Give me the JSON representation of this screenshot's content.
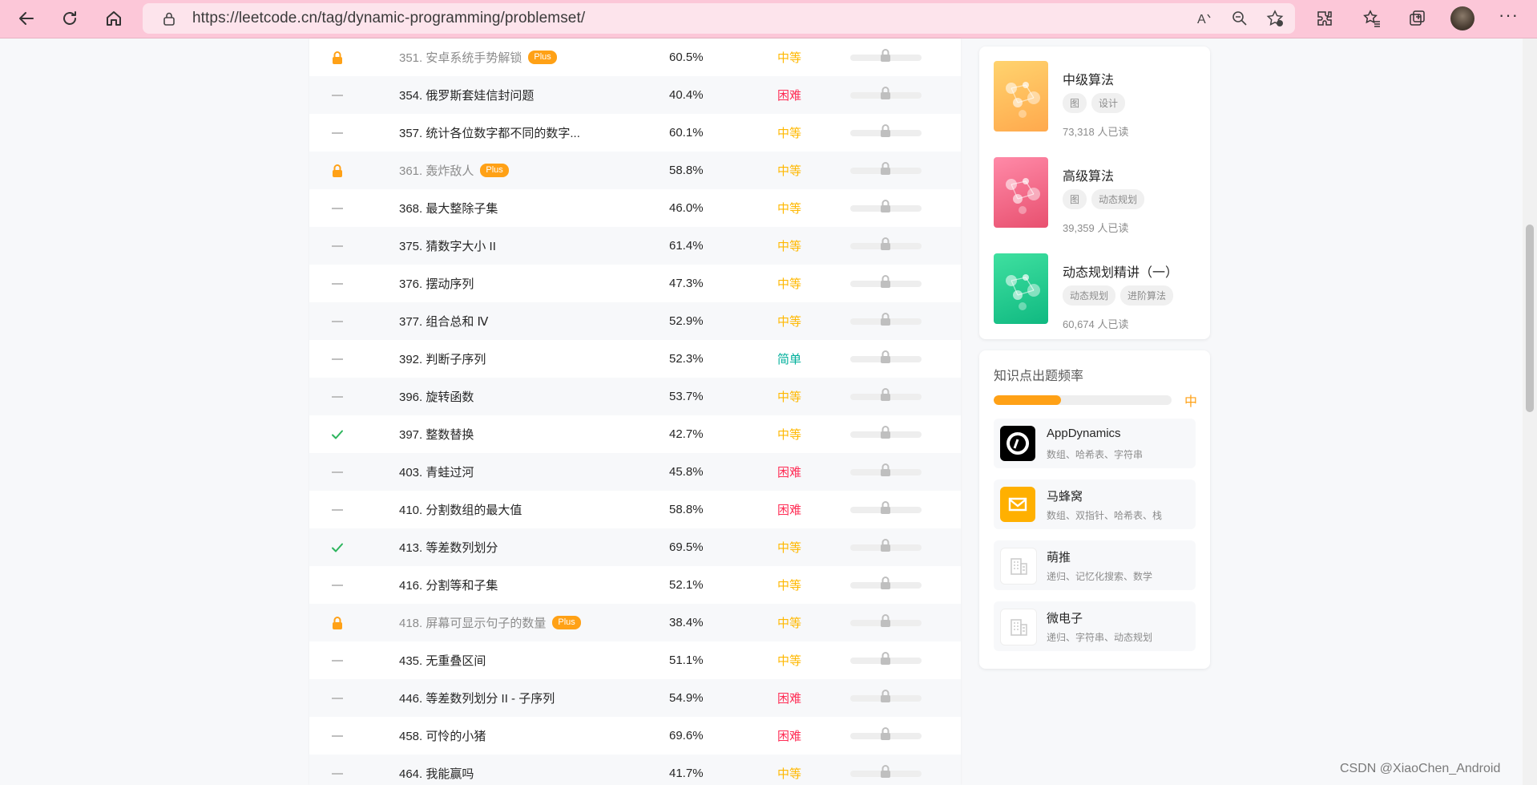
{
  "browser": {
    "url": "https://leetcode.cn/tag/dynamic-programming/problemset/"
  },
  "problems": [
    {
      "status": "locked",
      "title": "351. 安卓系统手势解锁",
      "plus": "Plus",
      "rate": "60.5%",
      "difficulty": "中等",
      "diff_color": "#ffb800"
    },
    {
      "status": "none",
      "title": "354. 俄罗斯套娃信封问题",
      "plus": "",
      "rate": "40.4%",
      "difficulty": "困难",
      "diff_color": "#ff2d55"
    },
    {
      "status": "none",
      "title": "357. 统计各位数字都不同的数字...",
      "plus": "",
      "rate": "60.1%",
      "difficulty": "中等",
      "diff_color": "#ffb800"
    },
    {
      "status": "locked",
      "title": "361. 轰炸敌人",
      "plus": "Plus",
      "rate": "58.8%",
      "difficulty": "中等",
      "diff_color": "#ffb800"
    },
    {
      "status": "none",
      "title": "368. 最大整除子集",
      "plus": "",
      "rate": "46.0%",
      "difficulty": "中等",
      "diff_color": "#ffb800"
    },
    {
      "status": "none",
      "title": "375. 猜数字大小 II",
      "plus": "",
      "rate": "61.4%",
      "difficulty": "中等",
      "diff_color": "#ffb800"
    },
    {
      "status": "none",
      "title": "376. 摆动序列",
      "plus": "",
      "rate": "47.3%",
      "difficulty": "中等",
      "diff_color": "#ffb800"
    },
    {
      "status": "none",
      "title": "377. 组合总和 Ⅳ",
      "plus": "",
      "rate": "52.9%",
      "difficulty": "中等",
      "diff_color": "#ffb800"
    },
    {
      "status": "none",
      "title": "392. 判断子序列",
      "plus": "",
      "rate": "52.3%",
      "difficulty": "简单",
      "diff_color": "#00af9b"
    },
    {
      "status": "none",
      "title": "396. 旋转函数",
      "plus": "",
      "rate": "53.7%",
      "difficulty": "中等",
      "diff_color": "#ffb800"
    },
    {
      "status": "solved",
      "title": "397. 整数替换",
      "plus": "",
      "rate": "42.7%",
      "difficulty": "中等",
      "diff_color": "#ffb800"
    },
    {
      "status": "none",
      "title": "403. 青蛙过河",
      "plus": "",
      "rate": "45.8%",
      "difficulty": "困难",
      "diff_color": "#ff2d55"
    },
    {
      "status": "none",
      "title": "410. 分割数组的最大值",
      "plus": "",
      "rate": "58.8%",
      "difficulty": "困难",
      "diff_color": "#ff2d55"
    },
    {
      "status": "solved",
      "title": "413. 等差数列划分",
      "plus": "",
      "rate": "69.5%",
      "difficulty": "中等",
      "diff_color": "#ffb800"
    },
    {
      "status": "none",
      "title": "416. 分割等和子集",
      "plus": "",
      "rate": "52.1%",
      "difficulty": "中等",
      "diff_color": "#ffb800"
    },
    {
      "status": "locked",
      "title": "418. 屏幕可显示句子的数量",
      "plus": "Plus",
      "rate": "38.4%",
      "difficulty": "中等",
      "diff_color": "#ffb800"
    },
    {
      "status": "none",
      "title": "435. 无重叠区间",
      "plus": "",
      "rate": "51.1%",
      "difficulty": "中等",
      "diff_color": "#ffb800"
    },
    {
      "status": "none",
      "title": "446. 等差数列划分 II - 子序列",
      "plus": "",
      "rate": "54.9%",
      "difficulty": "困难",
      "diff_color": "#ff2d55"
    },
    {
      "status": "none",
      "title": "458. 可怜的小猪",
      "plus": "",
      "rate": "69.6%",
      "difficulty": "困难",
      "diff_color": "#ff2d55"
    },
    {
      "status": "none",
      "title": "464. 我能赢吗",
      "plus": "",
      "rate": "41.7%",
      "difficulty": "中等",
      "diff_color": "#ffb800"
    }
  ],
  "books": [
    {
      "title": "中级算法",
      "tags": [
        "图",
        "设计"
      ],
      "reads": "73,318 人已读",
      "colors": [
        "#ffd36e",
        "#ffa94d"
      ]
    },
    {
      "title": "高级算法",
      "tags": [
        "图",
        "动态规划"
      ],
      "reads": "39,359 人已读",
      "colors": [
        "#ff8aa8",
        "#e8506f"
      ]
    },
    {
      "title": "动态规划精讲（一）",
      "tags": [
        "动态规划",
        "进阶算法"
      ],
      "reads": "60,674 人已读",
      "colors": [
        "#3fe0a0",
        "#10b981"
      ]
    }
  ],
  "frequency": {
    "title": "知识点出题频率",
    "level": "中",
    "fraction": 0.38,
    "color": "#ffa116"
  },
  "companies": [
    {
      "name": "AppDynamics",
      "tags": "数组、哈希表、字符串",
      "logo": "appdynamics"
    },
    {
      "name": "马蜂窝",
      "tags": "数组、双指针、哈希表、栈",
      "logo": "mafengwo"
    },
    {
      "name": "萌推",
      "tags": "递归、记忆化搜索、数学",
      "logo": "building"
    },
    {
      "name": "微电子",
      "tags": "递归、字符串、动态规划",
      "logo": "building"
    }
  ],
  "watermark": "CSDN @XiaoChen_Android"
}
